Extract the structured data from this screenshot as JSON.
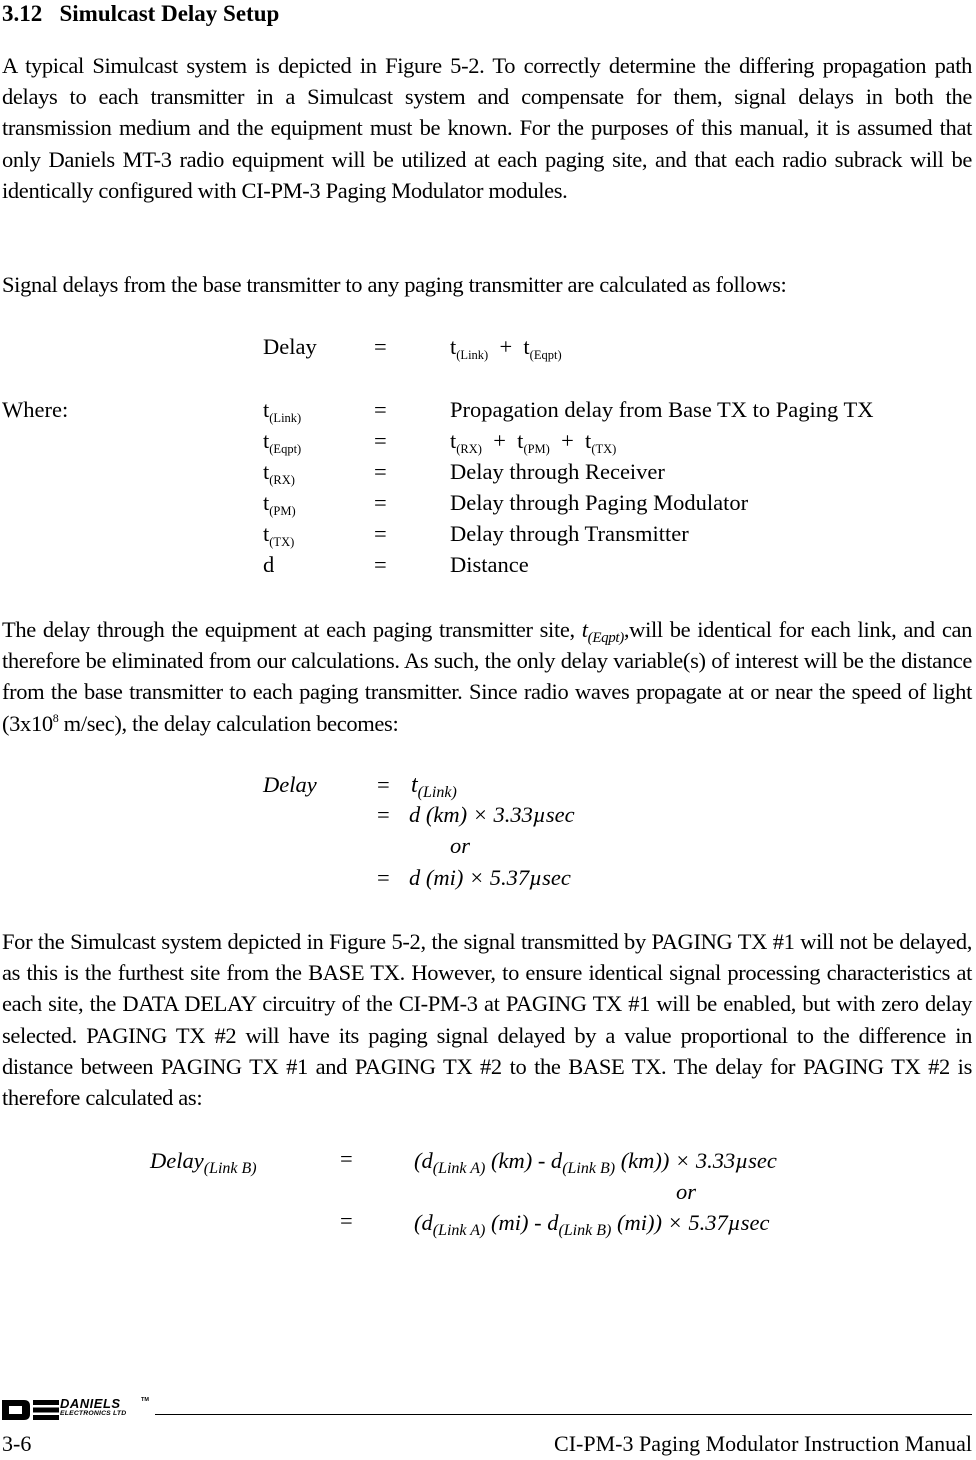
{
  "section": {
    "number": "3.12",
    "title": "Simulcast Delay Setup"
  },
  "paragraphs": {
    "intro": "A typical Simulcast system is depicted in Figure 5-2.  To correctly determine the differing propagation path delays to each transmitter in a Simulcast system and compensate for them, signal delays in both the transmission medium and the equipment must be known.  For the purposes of this manual, it is assumed that only Daniels MT-3 radio equipment will be utilized at each paging site, and that each radio subrack will be identically configured with CI-PM-3 Paging Modulator modules.",
    "calc_intro": "Signal delays from the base transmitter to any paging transmitter are calculated as follows:",
    "equipment_pre": "The delay through the equipment at each paging transmitter site, ",
    "equipment_var": "t",
    "equipment_sub": "(Eqpt)",
    "equipment_post": ",will be identical for each link, and can therefore be eliminated from our calculations.  As such, the only delay variable(s) of interest will be the distance from the base transmitter to each paging transmitter.  Since radio waves propagate at or near the speed of light (3x10",
    "equipment_exp": "8",
    "equipment_end": " m/sec), the delay calculation becomes:",
    "example": "For the Simulcast system depicted in Figure 5-2, the signal transmitted by PAGING TX #1 will not be delayed, as this is the furthest site from the BASE TX.  However, to ensure identical signal processing characteristics at each site, the DATA DELAY circuitry of the CI-PM-3 at PAGING TX #1 will be enabled, but with zero delay selected.  PAGING TX #2 will have its paging signal delayed by a value proportional to the difference in distance between PAGING TX #1 and PAGING TX #2 to the BASE TX.  The delay for PAGING TX #2 is therefore calculated as:"
  },
  "equation1": {
    "lhs": "Delay",
    "eq": "=",
    "t": "t",
    "plus": "+",
    "sub_link": "(Link)",
    "sub_eqpt": "(Eqpt)"
  },
  "definitions": {
    "where_label": "Where:",
    "rows": [
      {
        "sym": "t",
        "sub": "(Link)",
        "eq": "=",
        "desc": "Propagation delay from Base TX to Paging TX"
      },
      {
        "sym": "t",
        "sub": "(Eqpt)",
        "eq": "=",
        "desc_t": "t",
        "desc_subs": [
          "(RX)",
          "(PM)",
          "(TX)"
        ],
        "plus": "+"
      },
      {
        "sym": "t",
        "sub": "(RX)",
        "eq": "=",
        "desc": "Delay through Receiver"
      },
      {
        "sym": "t",
        "sub": "(PM)",
        "eq": "=",
        "desc": "Delay through Paging Modulator"
      },
      {
        "sym": "t",
        "sub": "(TX)",
        "eq": "=",
        "desc": "Delay through Transmitter"
      },
      {
        "sym": "d",
        "sub": "",
        "eq": "=",
        "desc": "Distance"
      }
    ]
  },
  "equation2": {
    "lhs": "Delay",
    "eq": "=",
    "line1_t": "t",
    "line1_sub": "(Link)",
    "line2": "d (km) ×  3.33µsec",
    "or": "or",
    "line3": "d (mi)  ×  5.37µsec"
  },
  "equation3": {
    "lhs": "Delay",
    "lhs_sub": "(Link B)",
    "eq": "=",
    "open": "(d",
    "sub_a": "(Link A)",
    "km": " (km)  -  d",
    "sub_b": "(Link B)",
    "km_end": " (km)) ×  3.33µsec",
    "or": "or",
    "mi": " (mi)  -  d",
    "mi_end": " (mi)) ×  5.37µsec"
  },
  "footer": {
    "logo_name": "DANIELS",
    "logo_tm": "TM",
    "logo_sub": "ELECTRONICS LTD",
    "page_number": "3-6",
    "manual_title": "CI-PM-3 Paging Modulator Instruction Manual"
  }
}
